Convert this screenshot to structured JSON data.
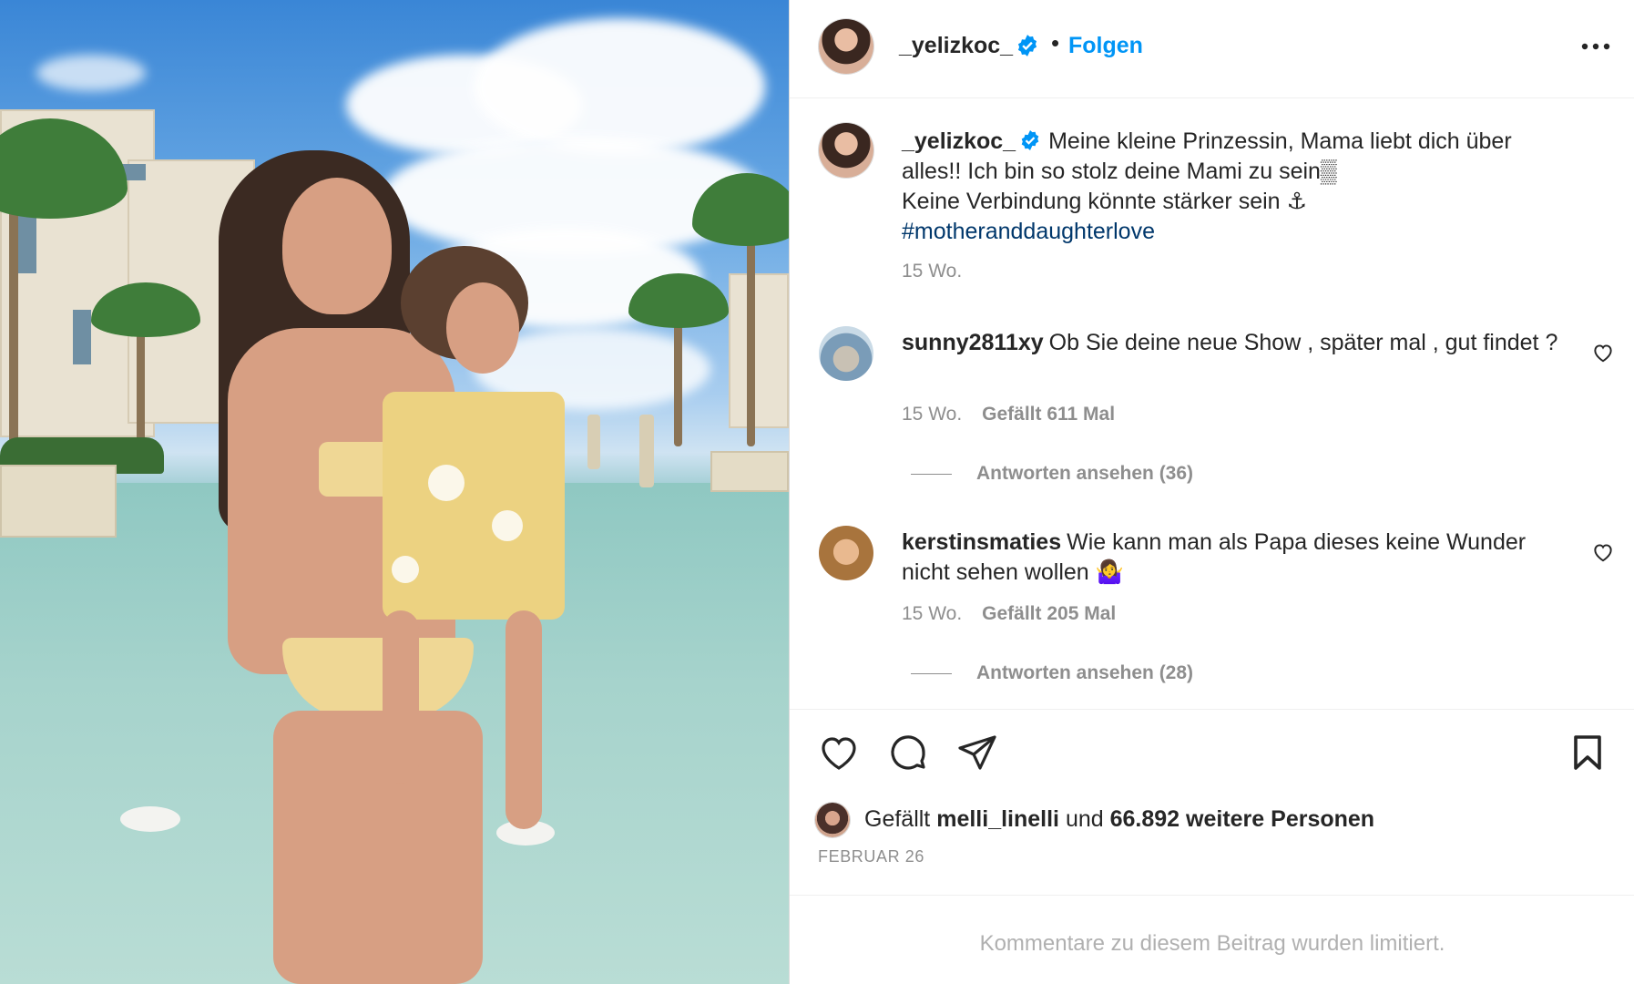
{
  "post": {
    "author": "_yelizkoc_",
    "follow_label": "Folgen",
    "separator": "•",
    "verified": true,
    "more_icon": "more-horizontal-icon"
  },
  "caption": {
    "author": "_yelizkoc_",
    "line1": "Meine kleine Prinzessin, Mama liebt dich über alles!! Ich bin so stolz deine Mami zu sein▒",
    "line2": "Keine Verbindung könnte stärker sein ⚓",
    "hashtag": "#motheranddaughterlove",
    "time": "15 Wo."
  },
  "comments": [
    {
      "author": "sunny2811xy",
      "text": "Ob Sie deine neue Show , später mal , gut findet ?",
      "time": "15 Wo.",
      "likes": "Gefällt 611 Mal",
      "replies": "Antworten ansehen (36)"
    },
    {
      "author": "kerstinsmaties",
      "text": "Wie kann man als Papa dieses keine Wunder nicht sehen wollen 🤷‍♀️",
      "time": "15 Wo.",
      "likes": "Gefällt 205 Mal",
      "replies": "Antworten ansehen (28)"
    }
  ],
  "actions": {
    "like_icon": "heart-icon",
    "comment_icon": "comment-bubble-icon",
    "share_icon": "paper-plane-icon",
    "save_icon": "bookmark-icon"
  },
  "likes": {
    "prefix": "Gefällt",
    "liker": "melli_linelli",
    "connector": "und",
    "others": "66.892 weitere Personen"
  },
  "date": "FEBRUAR 26",
  "comments_limited": "Kommentare zu diesem Beitrag wurden limitiert.",
  "colors": {
    "accent": "#0095f6",
    "hashtag": "#00376b",
    "muted": "#8e8e8e",
    "text": "#262626"
  }
}
